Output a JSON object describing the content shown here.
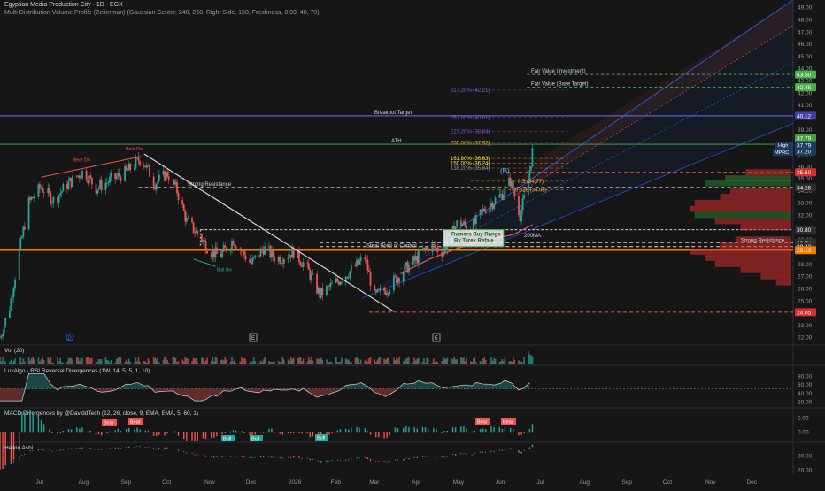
{
  "header": {
    "symbol_line": "Egyptian Media Production City · 1D · EGX",
    "indicator_line": "Multi Distribution Volume Profile (Zeiierman) (Gaussian Center, 240, 250, Right Side, 150, Freshness, 0.99, 40, 70)"
  },
  "x_axis": {
    "ticks": [
      "Jul",
      "Aug",
      "Sep",
      "Oct",
      "Nov",
      "Dec",
      "2026",
      "Feb",
      "Mar",
      "Apr",
      "May",
      "Jun",
      "Jul",
      "Aug",
      "Sep",
      "Oct",
      "Nov",
      "Dec"
    ]
  },
  "price_axis": {
    "ticks": [
      "49.00",
      "48.00",
      "47.00",
      "46.00",
      "45.00",
      "44.00",
      "43.00",
      "42.00",
      "41.00",
      "40.00",
      "39.00",
      "38.00",
      "37.00",
      "36.00",
      "35.00",
      "34.00",
      "33.00",
      "32.00",
      "31.00",
      "30.00",
      "29.00",
      "28.00",
      "27.00",
      "26.00",
      "25.00",
      "24.00",
      "23.00",
      "22.00"
    ],
    "badges": [
      {
        "label": "43.50",
        "color": "#4caf50",
        "value": 43.5
      },
      {
        "label": "42.45",
        "color": "#4caf50",
        "value": 42.45
      },
      {
        "label": "40.12",
        "color": "#3f3fa8",
        "value": 40.12
      },
      {
        "label": "37.79",
        "color": "#43a047",
        "value": 37.79
      },
      {
        "label": "37.79",
        "color": "#1e3a5f",
        "value": 37.79
      },
      {
        "label": "37.20",
        "color": "#1e3a5f",
        "value": 37.2
      },
      {
        "label": "35.50",
        "color": "#d32f2f",
        "value": 35.5
      },
      {
        "label": "34.26",
        "color": "#2e2e2e",
        "value": 34.26
      },
      {
        "label": "30.80",
        "color": "#2e2e2e",
        "value": 30.8
      },
      {
        "label": "29.74",
        "color": "#2e2e2e",
        "value": 29.74
      },
      {
        "label": "29.42",
        "color": "#2e2e2e",
        "value": 29.42
      },
      {
        "label": "29.13",
        "color": "#f57c00",
        "value": 29.13
      },
      {
        "label": "24.05",
        "color": "#d32f2f",
        "value": 24.05
      }
    ],
    "tags": [
      {
        "label": "High"
      },
      {
        "label": "MPRC"
      }
    ]
  },
  "annotations": {
    "bear_div_1": "Bear Div",
    "bear_div_2": "Bear Div",
    "bull_div": "Bull Div",
    "strong_resistance_left": "Strong Resistance",
    "strong_resistance_right": "Strong Resistance",
    "breakout_target": "Breakout Target",
    "ath": "ATH",
    "fair_value_investment": "Fair Value (investment)",
    "fair_value_base": "Fair Value (Base Target)",
    "fib_317": "317.20% (42.21)",
    "fib_261": "261.80% (40.01)",
    "fib_227": "227.20% (38.84)",
    "fib_200": "200.00% (37.92)",
    "fib_161": "161.80% (36.63)",
    "fib_150": "150.00% (36.24)",
    "fib_138": "138.20% (35.84)",
    "fib_05": "0.5 (34.77)",
    "fib_0618": "0.618 (34.08)",
    "fib_b": "(B)",
    "rumors_line1": "Rumors Buy Range",
    "rumors_line2": "By Tarek Refaie",
    "ma200": "200MA",
    "steal_point": "Steal Point of Control",
    "event_d": "D",
    "event_e1": "E",
    "event_e2": "E"
  },
  "panes": {
    "vol_title": "Vol (20)",
    "rsi_title": "LuxAlgo - RSI Reversal Divergences (1W, 14, 5, 5, 1, 10)",
    "rsi_ticks": [
      "80.00",
      "60.00",
      "40.00",
      "20.00"
    ],
    "macd_title": "MACD Divergences by @DaviddTech (12, 26, close, 9, EMA, EMA, 5, 60, 1)",
    "macd_ticks": [
      "2.00",
      "0.00"
    ],
    "macd_bear": "Bear",
    "macd_bull": "Bull",
    "ha_title": "Heikin Ashi",
    "ha_ticks": [
      "30.00",
      "20.00"
    ]
  },
  "colors": {
    "up": "#26a69a",
    "down": "#ef5350",
    "poc_orange": "#f57c00",
    "breakout_blue": "#5c5cdc",
    "ath_green": "#4caf50",
    "channel_blue": "#2962ff"
  },
  "chart_data": {
    "type": "candlestick",
    "symbol": "Egyptian Media Production City",
    "timeframe": "1D",
    "exchange": "EGX",
    "y_range": [
      21.8,
      49.3
    ],
    "x_range": [
      "2025-06-01",
      "2026-12-31"
    ],
    "months": [
      "Jul",
      "Aug",
      "Sep",
      "Oct",
      "Nov",
      "Dec",
      "2026",
      "Feb",
      "Mar",
      "Apr",
      "May",
      "Jun",
      "Jul",
      "Aug",
      "Sep",
      "Oct",
      "Nov",
      "Dec"
    ],
    "price_path": [
      {
        "date": "2025-06-01",
        "close": 22.0
      },
      {
        "date": "2025-06-08",
        "close": 24.5
      },
      {
        "date": "2025-06-15",
        "close": 29.0
      },
      {
        "date": "2025-06-22",
        "close": 33.0
      },
      {
        "date": "2025-07-01",
        "close": 34.3
      },
      {
        "date": "2025-07-10",
        "close": 33.2
      },
      {
        "date": "2025-07-20",
        "close": 34.5
      },
      {
        "date": "2025-08-01",
        "close": 35.6
      },
      {
        "date": "2025-08-10",
        "close": 34.2
      },
      {
        "date": "2025-08-20",
        "close": 34.8
      },
      {
        "date": "2025-09-01",
        "close": 35.5
      },
      {
        "date": "2025-09-12",
        "close": 36.7
      },
      {
        "date": "2025-09-22",
        "close": 34.6
      },
      {
        "date": "2025-10-01",
        "close": 35.4
      },
      {
        "date": "2025-10-08",
        "close": 34.0
      },
      {
        "date": "2025-10-15",
        "close": 31.5
      },
      {
        "date": "2025-10-25",
        "close": 30.2
      },
      {
        "date": "2025-11-01",
        "close": 29.1
      },
      {
        "date": "2025-11-08",
        "close": 28.6
      },
      {
        "date": "2025-11-18",
        "close": 30.0
      },
      {
        "date": "2025-12-01",
        "close": 28.0
      },
      {
        "date": "2025-12-10",
        "close": 29.3
      },
      {
        "date": "2025-12-20",
        "close": 28.4
      },
      {
        "date": "2026-01-01",
        "close": 29.0
      },
      {
        "date": "2026-01-10",
        "close": 27.8
      },
      {
        "date": "2026-01-20",
        "close": 25.5
      },
      {
        "date": "2026-02-01",
        "close": 26.5
      },
      {
        "date": "2026-02-12",
        "close": 27.5
      },
      {
        "date": "2026-02-22",
        "close": 28.5
      },
      {
        "date": "2026-03-01",
        "close": 25.3
      },
      {
        "date": "2026-03-10",
        "close": 26.0
      },
      {
        "date": "2026-03-20",
        "close": 27.2
      },
      {
        "date": "2026-04-01",
        "close": 28.5
      },
      {
        "date": "2026-04-10",
        "close": 29.5
      },
      {
        "date": "2026-04-20",
        "close": 29.0
      },
      {
        "date": "2026-05-01",
        "close": 31.5
      },
      {
        "date": "2026-05-10",
        "close": 30.8
      },
      {
        "date": "2026-05-20",
        "close": 32.5
      },
      {
        "date": "2026-06-01",
        "close": 33.6
      },
      {
        "date": "2026-06-08",
        "close": 34.8
      },
      {
        "date": "2026-06-15",
        "close": 32.0
      },
      {
        "date": "2026-06-20",
        "close": 34.2
      },
      {
        "date": "2026-06-24",
        "close": 37.2
      }
    ],
    "horizontal_levels": [
      {
        "label": "Fair Value (investment)",
        "value": 43.5
      },
      {
        "label": "Fair Value (Base Target)",
        "value": 42.45
      },
      {
        "label": "Breakout Target",
        "value": 40.12
      },
      {
        "label": "ATH",
        "value": 37.79
      },
      {
        "label": "High",
        "value": 37.79
      },
      {
        "label": "MPRC",
        "value": 37.2
      },
      {
        "value": 35.5
      },
      {
        "label": "Strong Resistance",
        "value": 34.26
      },
      {
        "value": 30.8
      },
      {
        "value": 29.74
      },
      {
        "value": 29.42
      },
      {
        "label": "Steal Point of Control",
        "value": 29.13
      },
      {
        "value": 24.05
      }
    ],
    "fib_levels": [
      {
        "label": "317.20%",
        "value": 42.21
      },
      {
        "label": "261.80%",
        "value": 40.01
      },
      {
        "label": "227.20%",
        "value": 38.84
      },
      {
        "label": "200.00%",
        "value": 37.92
      },
      {
        "label": "161.80%",
        "value": 36.63
      },
      {
        "label": "150.00%",
        "value": 36.24
      },
      {
        "label": "138.20%",
        "value": 35.84
      },
      {
        "label": "0.5",
        "value": 34.77
      },
      {
        "label": "0.618",
        "value": 34.08
      }
    ],
    "volume_profile": [
      {
        "price": 35.5,
        "width": 0.45,
        "color": "red"
      },
      {
        "price": 35.0,
        "width": 0.65,
        "color": "green"
      },
      {
        "price": 34.6,
        "width": 0.85,
        "color": "green"
      },
      {
        "price": 34.0,
        "width": 0.6,
        "color": "red"
      },
      {
        "price": 33.5,
        "width": 0.7,
        "color": "red"
      },
      {
        "price": 33.0,
        "width": 0.95,
        "color": "red"
      },
      {
        "price": 32.5,
        "width": 1.0,
        "color": "red"
      },
      {
        "price": 32.0,
        "width": 0.95,
        "color": "green"
      },
      {
        "price": 31.5,
        "width": 0.75,
        "color": "red"
      },
      {
        "price": 31.0,
        "width": 0.5,
        "color": "red"
      },
      {
        "price": 30.0,
        "width": 0.55,
        "color": "red"
      },
      {
        "price": 29.5,
        "width": 0.7,
        "color": "red"
      },
      {
        "price": 29.0,
        "width": 1.0,
        "color": "red"
      },
      {
        "price": 28.5,
        "width": 0.85,
        "color": "red"
      },
      {
        "price": 28.0,
        "width": 0.75,
        "color": "red"
      },
      {
        "price": 27.5,
        "width": 0.5,
        "color": "red"
      },
      {
        "price": 27.0,
        "width": 0.3,
        "color": "red"
      },
      {
        "price": 26.5,
        "width": 0.15,
        "color": "red"
      }
    ]
  }
}
